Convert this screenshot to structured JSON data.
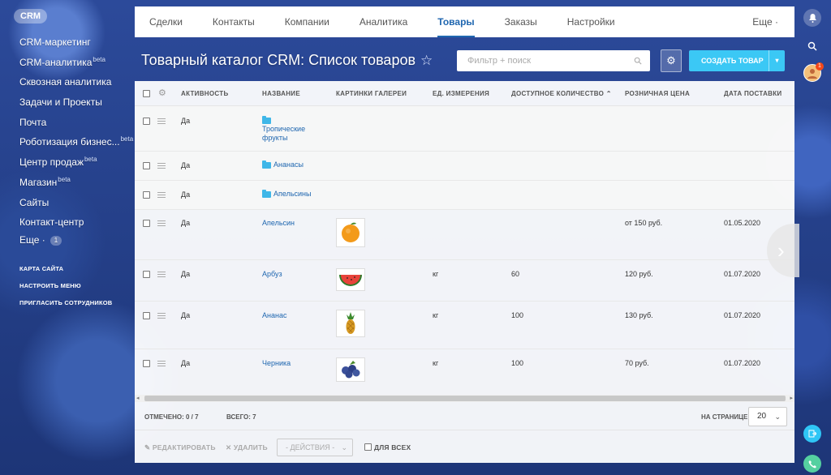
{
  "sidebar": {
    "crm_label": "CRM",
    "items": [
      {
        "label": "CRM-маркетинг",
        "sup": ""
      },
      {
        "label": "CRM-аналитика",
        "sup": "beta"
      },
      {
        "label": "Сквозная аналитика",
        "sup": ""
      },
      {
        "label": "Задачи и Проекты",
        "sup": ""
      },
      {
        "label": "Почта",
        "sup": ""
      },
      {
        "label": "Роботизация бизнес...",
        "sup": "beta"
      },
      {
        "label": "Центр продаж",
        "sup": "beta"
      },
      {
        "label": "Магазин",
        "sup": "beta"
      },
      {
        "label": "Сайты",
        "sup": ""
      },
      {
        "label": "Контакт-центр",
        "sup": ""
      },
      {
        "label": "Еще ·",
        "sup": ""
      }
    ],
    "more_count": "1",
    "links": [
      "КАРТА САЙТА",
      "НАСТРОИТЬ МЕНЮ",
      "ПРИГЛАСИТЬ СОТРУДНИКОВ"
    ]
  },
  "topnav": {
    "tabs": [
      "Сделки",
      "Контакты",
      "Компании",
      "Аналитика",
      "Товары",
      "Заказы",
      "Настройки"
    ],
    "active_tab": "Товары",
    "more": "Еще ·"
  },
  "header": {
    "title": "Товарный каталог CRM: Список товаров",
    "filter_placeholder": "Фильтр + поиск",
    "create_button": "СОЗДАТЬ ТОВАР"
  },
  "table": {
    "columns": [
      "АКТИВНОСТЬ",
      "НАЗВАНИЕ",
      "КАРТИНКИ ГАЛЕРЕИ",
      "ЕД. ИЗМЕРЕНИЯ",
      "ДОСТУПНОЕ КОЛИЧЕСТВО",
      "РОЗНИЧНАЯ ЦЕНА",
      "ДАТА ПОСТАВКИ"
    ],
    "sort_indicator": "⌃",
    "rows": [
      {
        "activity": "Да",
        "name": "Тропические фрукты",
        "folder": true,
        "image": "",
        "unit": "",
        "quantity": "",
        "price": "",
        "date": ""
      },
      {
        "activity": "Да",
        "name": "Ананасы",
        "folder": true,
        "image": "",
        "unit": "",
        "quantity": "",
        "price": "",
        "date": ""
      },
      {
        "activity": "Да",
        "name": "Апельсины",
        "folder": true,
        "image": "",
        "unit": "",
        "quantity": "",
        "price": "",
        "date": ""
      },
      {
        "activity": "Да",
        "name": "Апельсин",
        "folder": false,
        "image": "orange-icon",
        "unit": "",
        "quantity": "",
        "price": "от 150 руб.",
        "date": "01.05.2020"
      },
      {
        "activity": "Да",
        "name": "Арбуз",
        "folder": false,
        "image": "watermelon-icon",
        "unit": "кг",
        "quantity": "60",
        "price": "120 руб.",
        "date": "01.07.2020"
      },
      {
        "activity": "Да",
        "name": "Ананас",
        "folder": false,
        "image": "pineapple-icon",
        "unit": "кг",
        "quantity": "100",
        "price": "130 руб.",
        "date": "01.07.2020"
      },
      {
        "activity": "Да",
        "name": "Черника",
        "folder": false,
        "image": "blueberry-icon",
        "unit": "кг",
        "quantity": "100",
        "price": "70 руб.",
        "date": "01.07.2020"
      }
    ]
  },
  "footer": {
    "selected": "ОТМЕЧЕНО: 0 / 7",
    "total": "ВСЕГО: 7",
    "per_page_label": "НА СТРАНИЦЕ:",
    "per_page_value": "20",
    "edit": "РЕДАКТИРОВАТЬ",
    "delete": "УДАЛИТЬ",
    "actions": "- ДЕЙСТВИЯ -",
    "for_all": "ДЛЯ ВСЕХ"
  },
  "rightbar": {
    "notification_count": "1"
  },
  "colors": {
    "accent": "#2067b0",
    "create_button": "#3bc8f5",
    "folder": "#3fb7e8"
  }
}
